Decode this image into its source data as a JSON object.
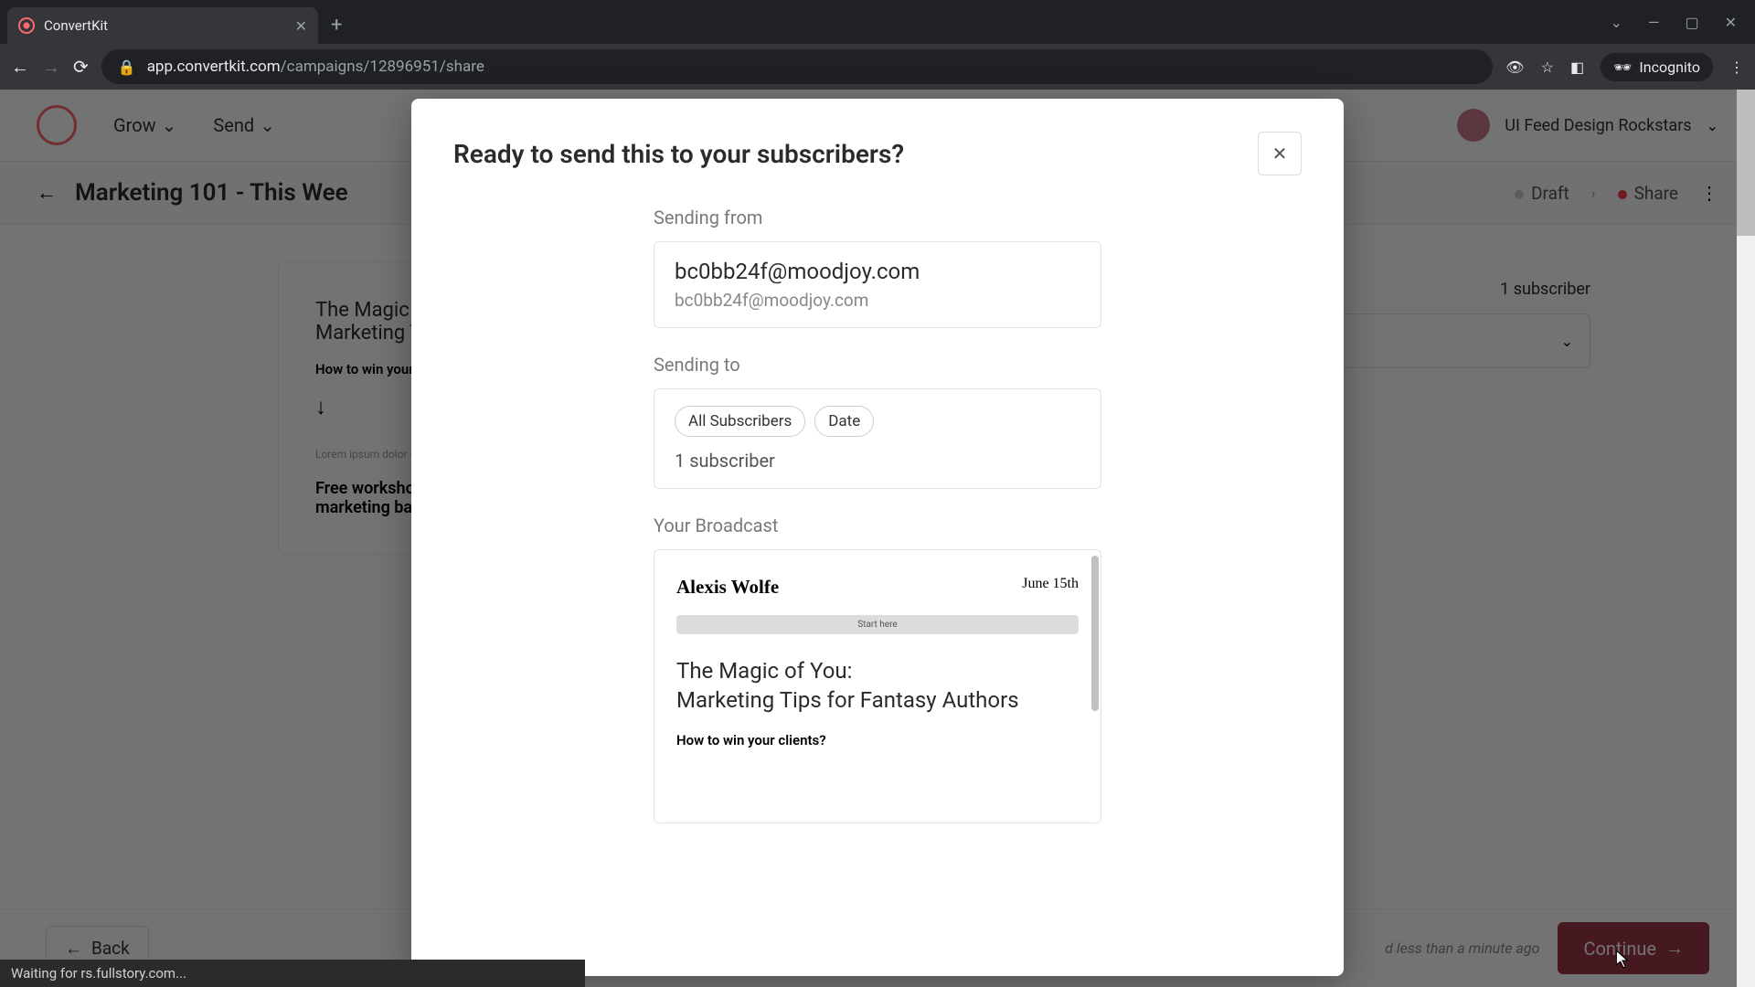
{
  "browser": {
    "tab_title": "ConvertKit",
    "url_host": "app.convertkit.com",
    "url_path": "/campaigns/12896951/share",
    "incognito_label": "Incognito",
    "status_bar": "Waiting for rs.fullstory.com..."
  },
  "app_nav": {
    "items": [
      "Grow",
      "Send"
    ],
    "account_name": "UI Feed Design Rockstars"
  },
  "page": {
    "title": "Marketing 101 - This Wee",
    "status_draft": "Draft",
    "status_share": "Share"
  },
  "preview": {
    "title_line1": "The Magic of",
    "title_line2": "Marketing Tip",
    "subheading": "How to win your client",
    "lorem": "Lorem ipsum dolor sit aliquet interdum dia, ali maximus consectetur e",
    "workshop_line1": "Free workshop",
    "workshop_line2": "marketing basi"
  },
  "side": {
    "subscriber_count": "1 subscriber"
  },
  "footer": {
    "back": "Back",
    "saved": "d less than a minute ago",
    "continue": "Continue"
  },
  "modal": {
    "title": "Ready to send this to your subscribers?",
    "sending_from_label": "Sending from",
    "from_primary": "bc0bb24f@moodjoy.com",
    "from_secondary": "bc0bb24f@moodjoy.com",
    "sending_to_label": "Sending to",
    "chips": [
      "All Subscribers",
      "Date"
    ],
    "subscriber_count": "1 subscriber",
    "broadcast_label": "Your Broadcast",
    "broadcast": {
      "author": "Alexis Wolfe",
      "date": "June 15th",
      "start_here": "Start here",
      "title_line1": "The Magic of You:",
      "title_line2": "Marketing Tips for Fantasy Authors",
      "sub": "How to win your clients?"
    }
  }
}
